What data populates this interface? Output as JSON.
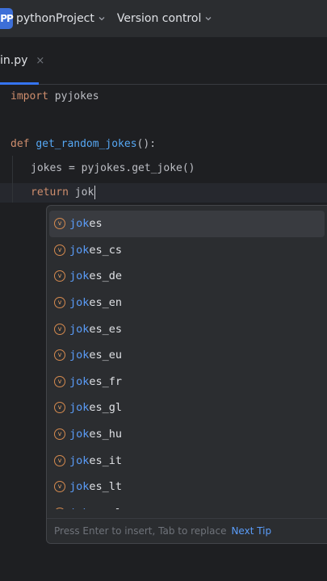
{
  "titlebar": {
    "badge": "PP",
    "project_name": "pythonProject",
    "version_control": "Version control"
  },
  "tab": {
    "label": "in.py",
    "close_glyph": "×"
  },
  "code": {
    "line1_kw": "import",
    "line1_rest": " pyjokes",
    "line3_kw": "def",
    "line3_fn": "get_random_jokes",
    "line3_rest": "():",
    "line4_var": "jokes",
    "line4_rest": " = pyjokes.get_joke()",
    "line5_kw": "return",
    "line5_rest": " jok"
  },
  "completion": {
    "icon_letter": "v",
    "items": [
      {
        "match": "jok",
        "rest": "es"
      },
      {
        "match": "jok",
        "rest": "es_cs"
      },
      {
        "match": "jok",
        "rest": "es_de"
      },
      {
        "match": "jok",
        "rest": "es_en"
      },
      {
        "match": "jok",
        "rest": "es_es"
      },
      {
        "match": "jok",
        "rest": "es_eu"
      },
      {
        "match": "jok",
        "rest": "es_fr"
      },
      {
        "match": "jok",
        "rest": "es_gl"
      },
      {
        "match": "jok",
        "rest": "es_hu"
      },
      {
        "match": "jok",
        "rest": "es_it"
      },
      {
        "match": "jok",
        "rest": "es_lt"
      },
      {
        "match": "jok",
        "rest": "es_pl"
      }
    ],
    "footer_hint": "Press Enter to insert, Tab to replace",
    "next_tip": "Next Tip"
  },
  "colors": {
    "keyword": "#cf8e6d",
    "function": "#56a8f5",
    "match": "#5a9cf8",
    "accent": "#3574f0"
  }
}
